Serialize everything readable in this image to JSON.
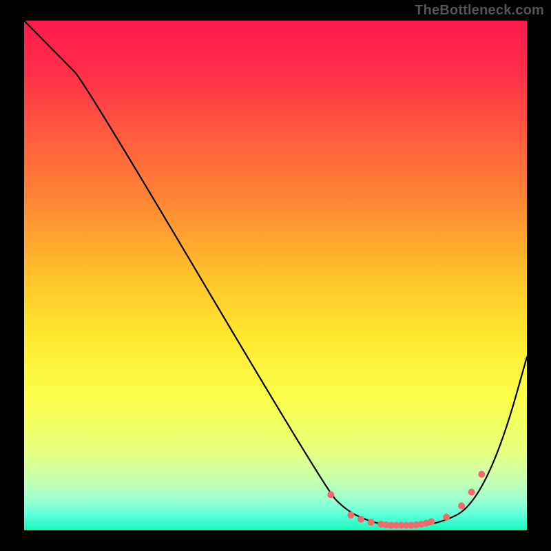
{
  "watermark": "TheBottleneck.com",
  "gradient": {
    "stops": [
      {
        "offset": 0.0,
        "color": "#ff1a4b"
      },
      {
        "offset": 0.1,
        "color": "#ff2e4a"
      },
      {
        "offset": 0.22,
        "color": "#ff5a3f"
      },
      {
        "offset": 0.35,
        "color": "#ff8534"
      },
      {
        "offset": 0.5,
        "color": "#ffc22a"
      },
      {
        "offset": 0.62,
        "color": "#ffe82e"
      },
      {
        "offset": 0.74,
        "color": "#fbff4a"
      },
      {
        "offset": 0.84,
        "color": "#e8ff7a"
      },
      {
        "offset": 0.9,
        "color": "#c8ffb0"
      },
      {
        "offset": 0.94,
        "color": "#9bffcf"
      },
      {
        "offset": 0.97,
        "color": "#5cffd8"
      },
      {
        "offset": 1.0,
        "color": "#17f7bd"
      }
    ]
  },
  "chart_data": {
    "type": "line",
    "title": "",
    "xlabel": "",
    "ylabel": "",
    "xlim": [
      0,
      100
    ],
    "ylim": [
      0,
      100
    ],
    "series": [
      {
        "name": "curve",
        "x": [
          0,
          8,
          12,
          60,
          64,
          68,
          72,
          76,
          80,
          84,
          88,
          92,
          96,
          100
        ],
        "y": [
          100,
          92,
          88,
          8,
          4,
          2,
          1,
          1,
          1,
          2,
          4,
          10,
          20,
          34
        ]
      }
    ],
    "markers": {
      "name": "dots",
      "x": [
        61,
        65,
        67,
        69,
        71,
        72,
        73,
        74,
        75,
        76,
        77,
        78,
        79,
        80,
        81,
        84,
        87,
        89,
        91
      ],
      "y": [
        7,
        3,
        2.2,
        1.6,
        1.2,
        1.1,
        1.0,
        1.0,
        1.0,
        1.0,
        1.0,
        1.1,
        1.2,
        1.4,
        1.7,
        2.6,
        4.8,
        7.5,
        11
      ],
      "color": "#ef6b6b",
      "radius": 5
    }
  }
}
